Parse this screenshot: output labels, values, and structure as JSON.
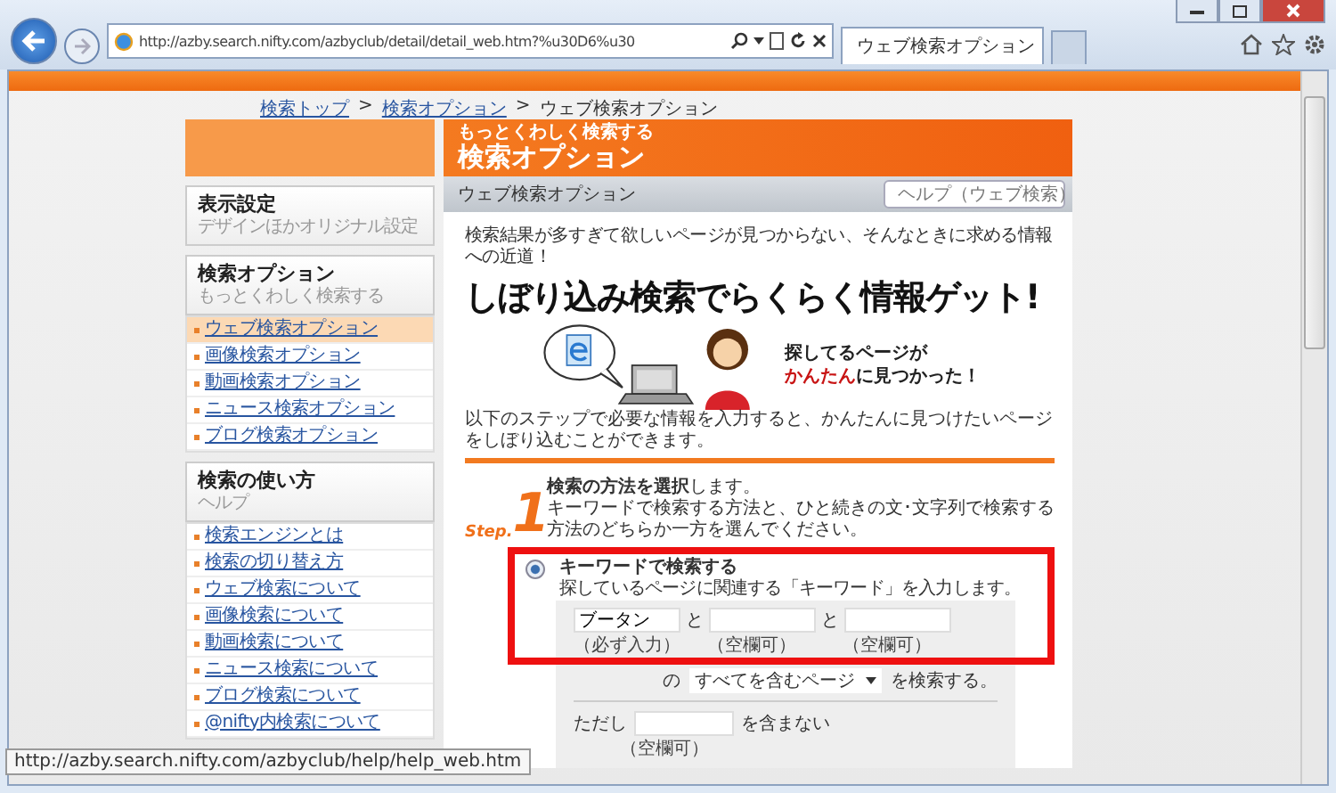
{
  "browser": {
    "address": "http://azby.search.nifty.com/azbyclub/detail/detail_web.htm?%u30D6%u30",
    "tabs": [
      {
        "title": "ウェブ検索オプション",
        "selected": true
      }
    ]
  },
  "breadcrumb": [
    {
      "label": "検索トップ",
      "kind": "link"
    },
    {
      "label": ">",
      "kind": "separator"
    },
    {
      "label": "検索オプション",
      "kind": "link"
    },
    {
      "label": ">",
      "kind": "separator"
    },
    {
      "label": "ウェブ検索オプション",
      "kind": "current"
    }
  ],
  "sidebar": {
    "sections": [
      {
        "title": "表示設定",
        "subtitle": "デザインほかオリジナル設定"
      },
      {
        "title": "検索オプション",
        "subtitle": "もっとくわしく検索する",
        "items": [
          {
            "label": "ウェブ検索オプション",
            "selected": true
          },
          {
            "label": "画像検索オプション",
            "selected": false
          },
          {
            "label": "動画検索オプション",
            "selected": false
          },
          {
            "label": "ニュース検索オプション",
            "selected": false
          },
          {
            "label": "ブログ検索オプション",
            "selected": false
          }
        ]
      },
      {
        "title": "検索の使い方",
        "subtitle": "ヘルプ",
        "items": [
          {
            "label": "検索エンジンとは",
            "selected": false
          },
          {
            "label": "検索の切り替え方",
            "selected": false
          },
          {
            "label": "ウェブ検索について",
            "selected": false
          },
          {
            "label": "画像検索について",
            "selected": false
          },
          {
            "label": "動画検索について",
            "selected": false
          },
          {
            "label": "ニュース検索について",
            "selected": false
          },
          {
            "label": "ブログ検索について",
            "selected": false
          },
          {
            "label": "@nifty内検索について",
            "selected": false
          }
        ]
      }
    ]
  },
  "header": {
    "kicker": "もっとくわしく検索する",
    "title": "検索オプション"
  },
  "subheader": {
    "title": "ウェブ検索オプション",
    "help": "ヘルプ（ウェブ検索）"
  },
  "intro": {
    "lead": "検索結果が多すぎて欲しいページが見つからない、そんなときに求める情報への近道！",
    "headline": "しぼり込み検索でらくらく情報ゲット!",
    "caption_top": "探してるページが",
    "caption_highlight": "かんたん",
    "caption_rest": "に見つかった！"
  },
  "instructions": "以下のステップで必要な情報を入力すると、かんたんに見つけたいページをしぼり込むことができます。",
  "step": {
    "label": "Step.",
    "number": "1",
    "title": "**検索の方法を選択**します。",
    "text": "キーワードで検索する方法と、ひと続きの文･文字列で検索する方法のどちらか一方を選んでください。"
  },
  "option": {
    "label": "キーワードで検索する",
    "selected": true,
    "description": "探しているページに関連する「キーワード」を入力します。",
    "keywords": [
      {
        "value": "ブータン",
        "note": "（必ず入力）"
      },
      {
        "joiner": "と",
        "note": "（空欄可）"
      },
      {
        "joiner": "と",
        "note": "（空欄可）"
      }
    ]
  },
  "match": {
    "prefix": "の",
    "value": "すべてを含むページ",
    "suffix": "を検索する。"
  },
  "exclude": {
    "prefix": "ただし",
    "suffix": "を含まない",
    "note": "（空欄可）"
  },
  "status_url": "http://azby.search.nifty.com/azbyclub/help/help_web.htm"
}
